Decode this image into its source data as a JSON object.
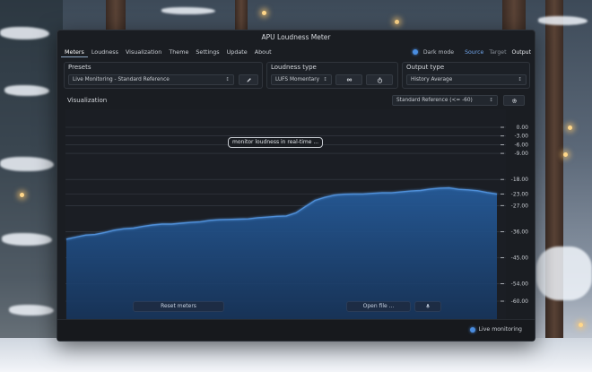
{
  "window": {
    "title": "APU Loudness Meter"
  },
  "menu": {
    "items": [
      "Meters",
      "Loudness",
      "Visualization",
      "Theme",
      "Settings",
      "Update",
      "About"
    ],
    "active": 0
  },
  "header_right": {
    "dark_mode_label": "Dark mode",
    "dark_mode_on": true,
    "segments": [
      "Source",
      "Target",
      "Output"
    ]
  },
  "presets": {
    "label": "Presets",
    "selected": "Live Monitoring - Standard Reference"
  },
  "loudness_type": {
    "label": "Loudness type",
    "selected": "LUFS Momentary"
  },
  "output_type": {
    "label": "Output type",
    "selected": "History Average"
  },
  "visualization": {
    "label": "Visualization",
    "reference_select": "Standard Reference (<= -60)"
  },
  "chart_data": {
    "type": "area",
    "y_ticks": [
      "0.00",
      "-3.00",
      "-6.00",
      "-9.00",
      "-18.00",
      "-23.00",
      "-27.00",
      "-36.00",
      "-45.00",
      "-54.00",
      "-60.00"
    ],
    "ylim": [
      -60,
      0
    ],
    "grid": true,
    "y": [
      -38.6,
      -37.9,
      -37.2,
      -37.0,
      -36.3,
      -35.5,
      -35.0,
      -34.8,
      -34.2,
      -33.7,
      -33.4,
      -33.4,
      -33.1,
      -32.8,
      -32.6,
      -32.1,
      -31.9,
      -31.8,
      -31.7,
      -31.6,
      -31.2,
      -31.0,
      -30.7,
      -30.6,
      -29.5,
      -27.3,
      -25.2,
      -24.2,
      -23.4,
      -23.1,
      -23.0,
      -23.0,
      -22.8,
      -22.6,
      -22.6,
      -22.3,
      -22.0,
      -21.8,
      -21.3,
      -21.0,
      -20.9,
      -21.4,
      -21.6,
      -21.9,
      -22.5,
      -23.0
    ]
  },
  "tooltip": {
    "text": "monitor loudness in real-time ..."
  },
  "overlay_buttons": {
    "reset": "Reset meters",
    "open": "Open file ..."
  },
  "status": {
    "live_label": "Live monitoring",
    "live_on": true
  },
  "colors": {
    "accent": "#4a8de0",
    "area_fill": "#1f4f86",
    "area_line": "#4f8fd8",
    "window_bg": "#1a1d22"
  }
}
